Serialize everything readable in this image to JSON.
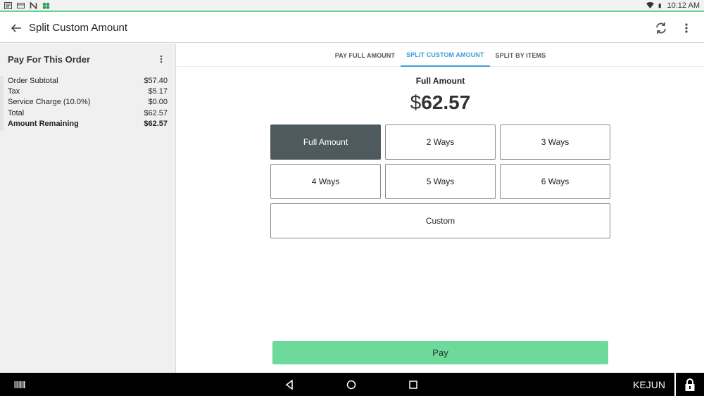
{
  "status_bar": {
    "time": "10:12 AM",
    "icons": [
      "app-icon",
      "card-icon",
      "n-icon",
      "clover-icon",
      "wifi-icon",
      "battery-icon"
    ]
  },
  "app_bar": {
    "title": "Split Custom Amount",
    "icons": [
      "back-arrow-icon",
      "refresh-icon",
      "more-vert-icon"
    ]
  },
  "left_panel": {
    "heading": "Pay For This Order",
    "rows": [
      {
        "label": "Order Subtotal",
        "value": "$57.40"
      },
      {
        "label": "Tax",
        "value": "$5.17"
      },
      {
        "label": "Service Charge (10.0%)",
        "value": "$0.00"
      },
      {
        "label": "Total",
        "value": "$62.57"
      },
      {
        "label": "Amount Remaining",
        "value": "$62.57"
      }
    ]
  },
  "tabs": [
    {
      "label": "PAY FULL AMOUNT",
      "active": false
    },
    {
      "label": "SPLIT CUSTOM AMOUNT",
      "active": true
    },
    {
      "label": "SPLIT BY ITEMS",
      "active": false
    }
  ],
  "amount": {
    "label": "Full Amount",
    "currency": "$",
    "value": "62.57"
  },
  "split_options": {
    "row1": [
      "Full Amount",
      "2 Ways",
      "3 Ways"
    ],
    "row2": [
      "4 Ways",
      "5 Ways",
      "6 Ways"
    ],
    "custom": "Custom",
    "selected": "Full Amount"
  },
  "pay_button": "Pay",
  "nav_bar": {
    "user": "KEJUN",
    "icons": [
      "barcode-icon",
      "back-triangle-icon",
      "home-circle-icon",
      "recents-square-icon",
      "lock-icon"
    ]
  },
  "colors": {
    "accent_green": "#6dd99a",
    "tab_active": "#3aa0d8",
    "selected_button": "#4f5a5e",
    "status_line": "#5fd38c"
  }
}
